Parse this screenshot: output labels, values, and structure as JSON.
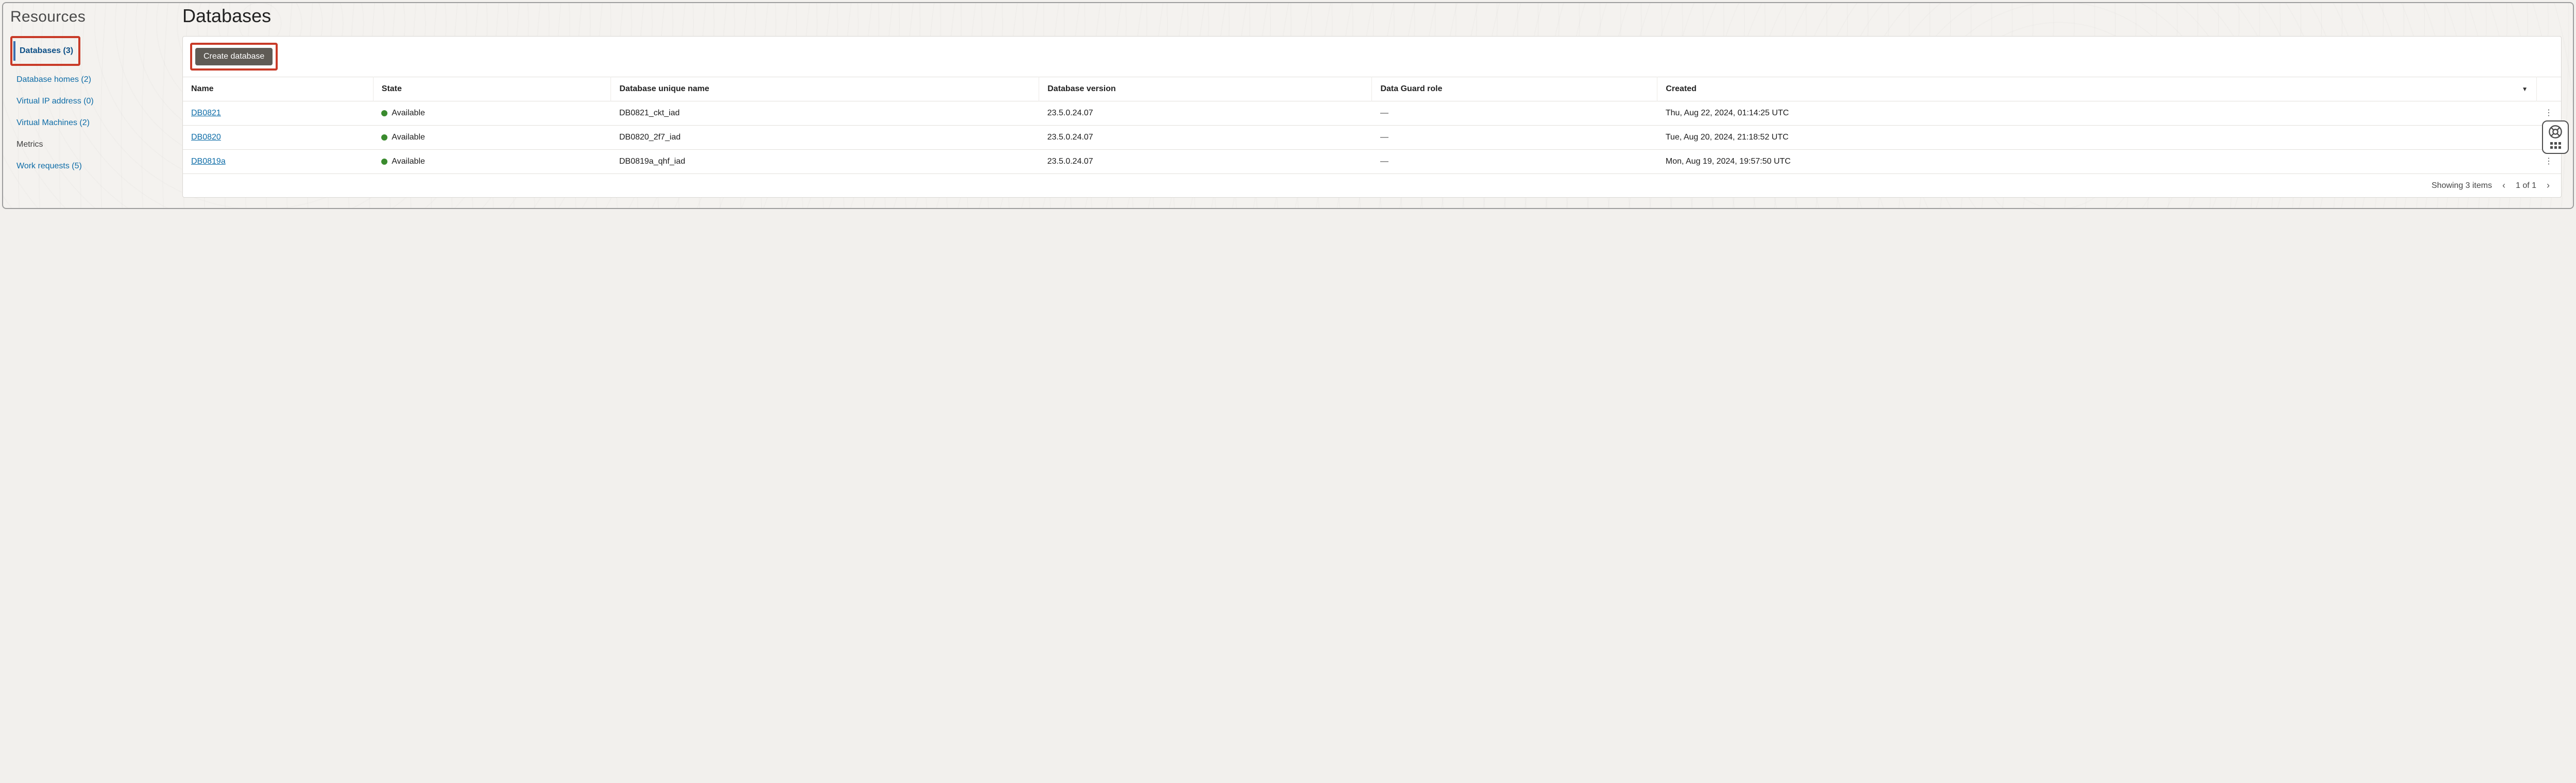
{
  "sidebar": {
    "title": "Resources",
    "items": [
      {
        "label": "Databases (3)",
        "active": true,
        "highlight": true
      },
      {
        "label": "Database homes (2)"
      },
      {
        "label": "Virtual IP address (0)"
      },
      {
        "label": "Virtual Machines (2)"
      },
      {
        "label": "Metrics",
        "muted": true
      },
      {
        "label": "Work requests (5)"
      }
    ]
  },
  "page": {
    "title": "Databases"
  },
  "toolbar": {
    "create_label": "Create database"
  },
  "table": {
    "headers": {
      "name": "Name",
      "state": "State",
      "unique_name": "Database unique name",
      "version": "Database version",
      "role": "Data Guard role",
      "created": "Created"
    },
    "rows": [
      {
        "name": "DB0821",
        "state_label": "Available",
        "state_color": "#3a8b2e",
        "unique_name": "DB0821_ckt_iad",
        "version": "23.5.0.24.07",
        "role": "—",
        "created": "Thu, Aug 22, 2024, 01:14:25 UTC"
      },
      {
        "name": "DB0820",
        "state_label": "Available",
        "state_color": "#3a8b2e",
        "unique_name": "DB0820_2f7_iad",
        "version": "23.5.0.24.07",
        "role": "—",
        "created": "Tue, Aug 20, 2024, 21:18:52 UTC"
      },
      {
        "name": "DB0819a",
        "state_label": "Available",
        "state_color": "#3a8b2e",
        "unique_name": "DB0819a_qhf_iad",
        "version": "23.5.0.24.07",
        "role": "—",
        "created": "Mon, Aug 19, 2024, 19:57:50 UTC"
      }
    ]
  },
  "footer": {
    "summary": "Showing 3 items",
    "page_label": "1 of 1"
  }
}
